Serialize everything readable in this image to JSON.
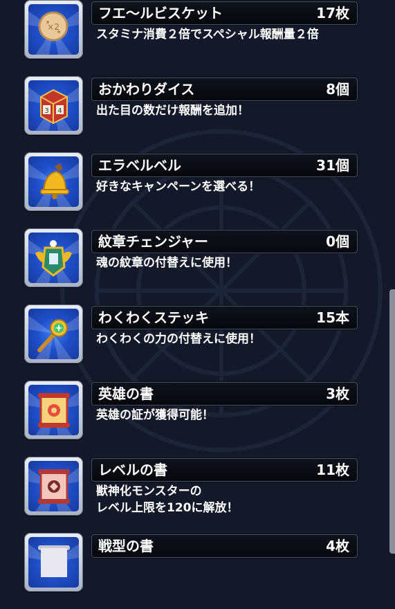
{
  "items": [
    {
      "name": "フエ〜ルビスケット",
      "count": "17枚",
      "description": "スタミナ消費２倍でスペシャル報酬量２倍",
      "icon": "biscuit-icon"
    },
    {
      "name": "おかわりダイス",
      "count": "8個",
      "description": "出た目の数だけ報酬を追加！",
      "icon": "dice-icon"
    },
    {
      "name": "エラベルベル",
      "count": "31個",
      "description": "好きなキャンペーンを選べる！",
      "icon": "bell-icon"
    },
    {
      "name": "紋章チェンジャー",
      "count": "0個",
      "description": "魂の紋章の付替えに使用！",
      "icon": "emblem-changer-icon"
    },
    {
      "name": "わくわくステッキ",
      "count": "15本",
      "description": "わくわくの力の付替えに使用！",
      "icon": "wand-icon"
    },
    {
      "name": "英雄の書",
      "count": "3枚",
      "description": "英雄の証が獲得可能！",
      "icon": "hero-scroll-icon"
    },
    {
      "name": "レベルの書",
      "count": "11枚",
      "description": "獣神化モンスターの\nレベル上限を120に解放！",
      "icon": "level-scroll-icon"
    },
    {
      "name": "戦型の書",
      "count": "4枚",
      "description": "",
      "icon": "battle-scroll-icon"
    }
  ],
  "colors": {
    "background": "#14192a",
    "icon_blue": "#1f4fc9",
    "name_bar": "#05070c",
    "text": "#ffffff"
  }
}
